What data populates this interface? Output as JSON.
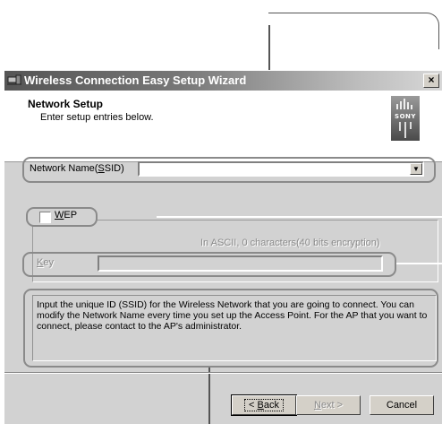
{
  "window": {
    "title": "Wireless Connection Easy Setup Wizard",
    "close_label": "×"
  },
  "header": {
    "title": "Network Setup",
    "subtitle": "Enter setup entries below.",
    "logo_text": "SONY"
  },
  "ssid": {
    "label_before": "Network Name(",
    "label_accel": "S",
    "label_after": "SID)",
    "value": "",
    "dropdown_glyph": "▼"
  },
  "wep": {
    "label_accel": "W",
    "label_rest": "EP",
    "checked": false,
    "status": "In ASCII, 0 characters(40 bits encryption)",
    "key_label_accel": "K",
    "key_label_rest": "ey",
    "key_value": ""
  },
  "info": {
    "text": "Input the unique ID (SSID) for the Wireless Network that you are going to connect. You can modify the Network Name every time you set up the Access Point. For the AP that you want to connect, please contact to the AP's administrator."
  },
  "buttons": {
    "back_prefix": "< ",
    "back_accel": "B",
    "back_rest": "ack",
    "next_accel": "N",
    "next_rest": "ext >",
    "cancel": "Cancel"
  },
  "colors": {
    "highlight": "#8a8a8a",
    "dialog_bg": "#d2d2d2",
    "title_start": "#555555"
  }
}
